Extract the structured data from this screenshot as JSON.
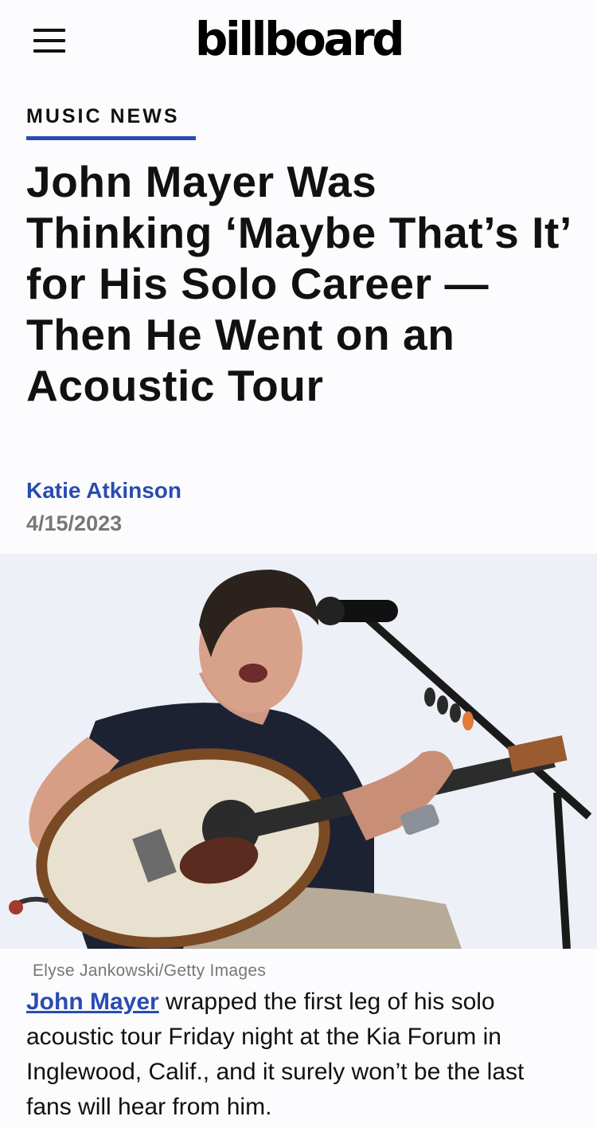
{
  "header": {
    "logo_text": "billboard",
    "menu_icon": "hamburger-menu-icon"
  },
  "article": {
    "section": "MUSIC NEWS",
    "headline": "John Mayer Was Thinking ‘Maybe That’s It’ for His Solo Career — Then He Went on an Acoustic Tour",
    "author": "Katie Atkinson",
    "date": "4/15/2023",
    "photo_credit": "Elyse Jankowski/Getty Images",
    "body": {
      "link_text": "John Mayer",
      "text": " wrapped the first leg of his solo acoustic tour Friday night at the Kia Forum in Inglewood, Calif., and it surely won’t be the last fans will hear from him."
    }
  },
  "colors": {
    "accent": "#2a4bb0",
    "text": "#111111",
    "muted": "#777777",
    "background": "#fcfcfe"
  }
}
